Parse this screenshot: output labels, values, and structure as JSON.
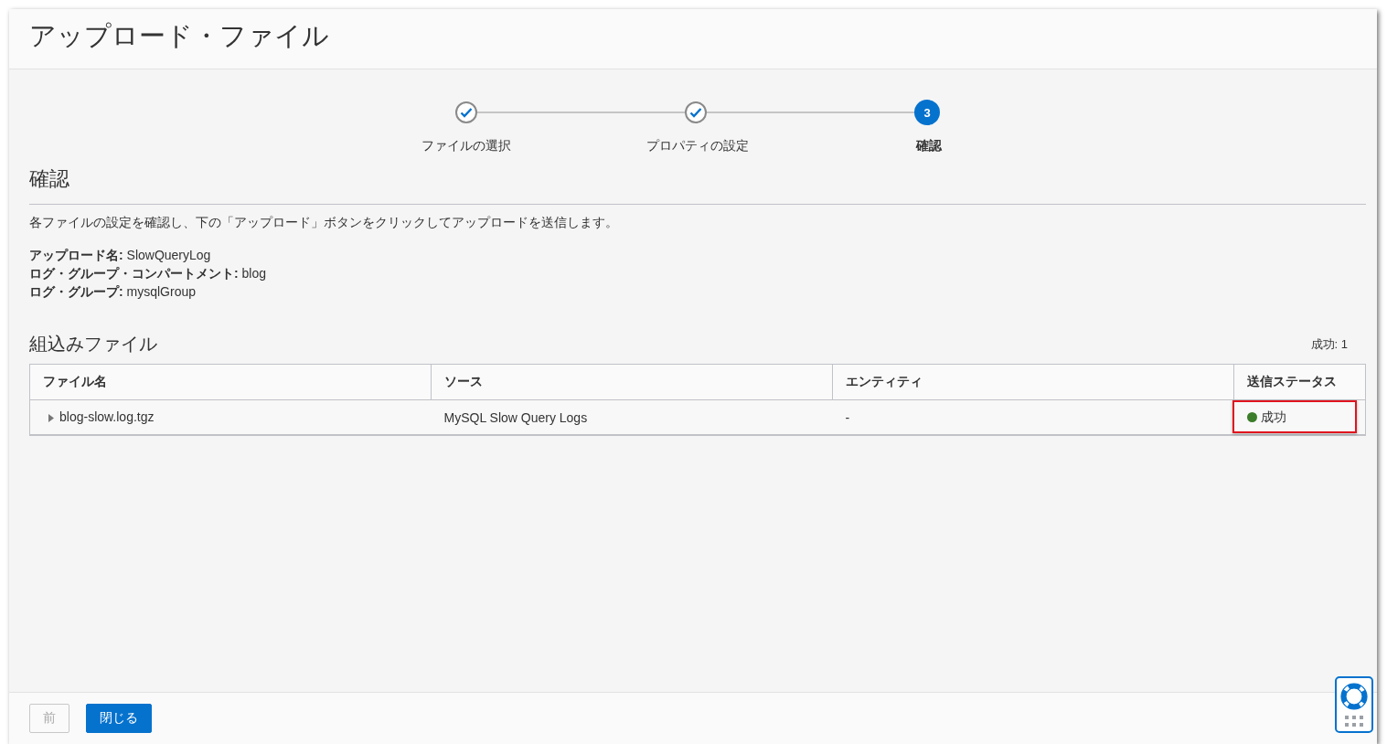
{
  "dialog": {
    "title": "アップロード・ファイル"
  },
  "steps": [
    {
      "label": "ファイルの選択",
      "completed": true,
      "current": false
    },
    {
      "label": "プロパティの設定",
      "completed": true,
      "current": false
    },
    {
      "label": "確認",
      "completed": false,
      "current": true,
      "number": "3"
    }
  ],
  "section": {
    "title": "確認",
    "description": "各ファイルの設定を確認し、下の「アップロード」ボタンをクリックしてアップロードを送信します。",
    "details": [
      "**アップロード名:** SlowQueryLog",
      "**ログ・グループ・コンパートメント:** blog",
      "**ログ・グループ:** mysqlGroup"
    ]
  },
  "files": {
    "title": "組込みファイル",
    "summary": "成功: 1",
    "columns": [
      "ファイル名",
      "ソース",
      "エンティティ",
      "送信ステータス"
    ],
    "rows": [
      {
        "expanded": false,
        "file": "blog-slow.log.tgz",
        "source": "MySQL Slow Query Logs",
        "entity": "-",
        "status": {
          "text": "成功",
          "color": "#3b7d2a"
        },
        "highlighted": true
      }
    ]
  },
  "footer": {
    "buttons": [
      {
        "label": "前",
        "kind": "secondary",
        "disabled": true
      },
      {
        "label": "閉じる",
        "kind": "primary",
        "disabled": false
      }
    ]
  }
}
